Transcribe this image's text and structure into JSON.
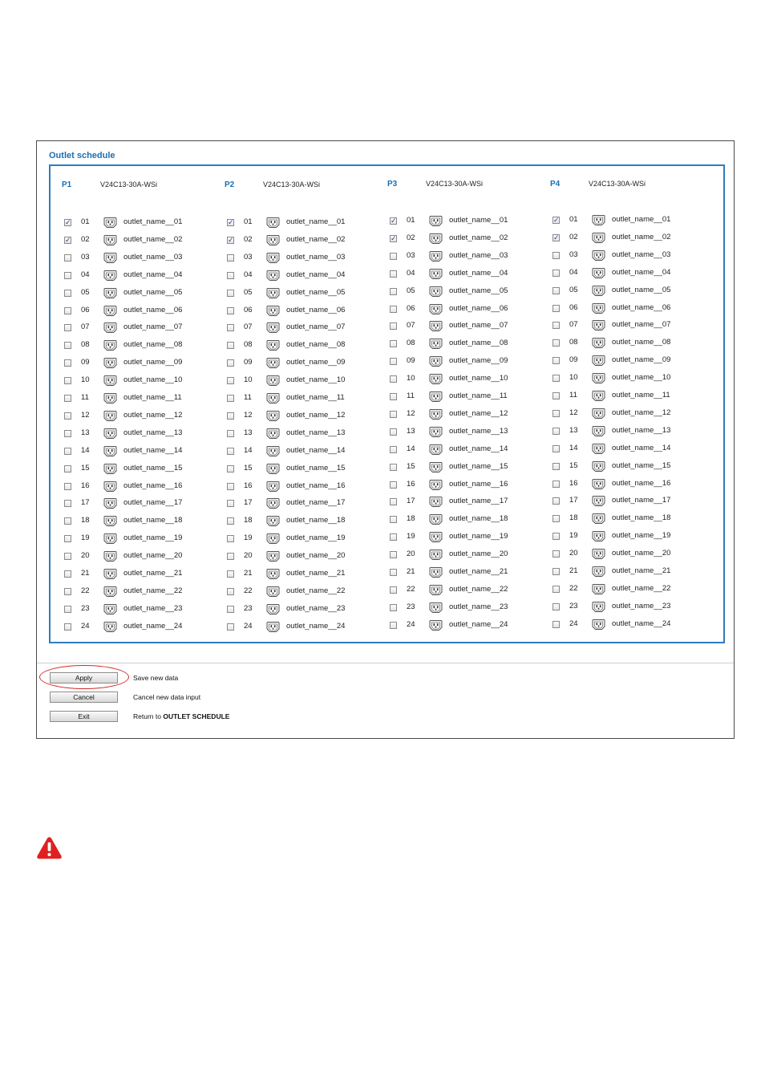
{
  "section_title": "Outlet schedule",
  "colors": {
    "title": "#1a6fb3",
    "panel_border": "#2f7cc0",
    "highlight": "#d42a2a",
    "warning": "#e02020"
  },
  "pdus": [
    {
      "id": "P1",
      "model": "V24C13-30A-WSi"
    },
    {
      "id": "P2",
      "model": "V24C13-30A-WSi"
    },
    {
      "id": "P3",
      "model": "V24C13-30A-WSi"
    },
    {
      "id": "P4",
      "model": "V24C13-30A-WSi"
    }
  ],
  "outlets": [
    {
      "num": "01",
      "name": "outlet_name__01",
      "checked": true
    },
    {
      "num": "02",
      "name": "outlet_name__02",
      "checked": true
    },
    {
      "num": "03",
      "name": "outlet_name__03",
      "checked": false
    },
    {
      "num": "04",
      "name": "outlet_name__04",
      "checked": false
    },
    {
      "num": "05",
      "name": "outlet_name__05",
      "checked": false
    },
    {
      "num": "06",
      "name": "outlet_name__06",
      "checked": false
    },
    {
      "num": "07",
      "name": "outlet_name__07",
      "checked": false
    },
    {
      "num": "08",
      "name": "outlet_name__08",
      "checked": false
    },
    {
      "num": "09",
      "name": "outlet_name__09",
      "checked": false
    },
    {
      "num": "10",
      "name": "outlet_name__10",
      "checked": false
    },
    {
      "num": "11",
      "name": "outlet_name__11",
      "checked": false
    },
    {
      "num": "12",
      "name": "outlet_name__12",
      "checked": false
    },
    {
      "num": "13",
      "name": "outlet_name__13",
      "checked": false
    },
    {
      "num": "14",
      "name": "outlet_name__14",
      "checked": false
    },
    {
      "num": "15",
      "name": "outlet_name__15",
      "checked": false
    },
    {
      "num": "16",
      "name": "outlet_name__16",
      "checked": false
    },
    {
      "num": "17",
      "name": "outlet_name__17",
      "checked": false
    },
    {
      "num": "18",
      "name": "outlet_name__18",
      "checked": false
    },
    {
      "num": "19",
      "name": "outlet_name__19",
      "checked": false
    },
    {
      "num": "20",
      "name": "outlet_name__20",
      "checked": false
    },
    {
      "num": "21",
      "name": "outlet_name__21",
      "checked": false
    },
    {
      "num": "22",
      "name": "outlet_name__22",
      "checked": false
    },
    {
      "num": "23",
      "name": "outlet_name__23",
      "checked": false
    },
    {
      "num": "24",
      "name": "outlet_name__24",
      "checked": false
    }
  ],
  "actions": {
    "apply": {
      "label": "Apply",
      "description": "Save new data"
    },
    "cancel": {
      "label": "Cancel",
      "description": "Cancel new data input"
    },
    "exit": {
      "label": "Exit",
      "description_prefix": "Return to ",
      "description_target": "OUTLET SCHEDULE"
    }
  },
  "icons": {
    "outlet": "c13-outlet-icon",
    "warning": "warning-icon"
  }
}
